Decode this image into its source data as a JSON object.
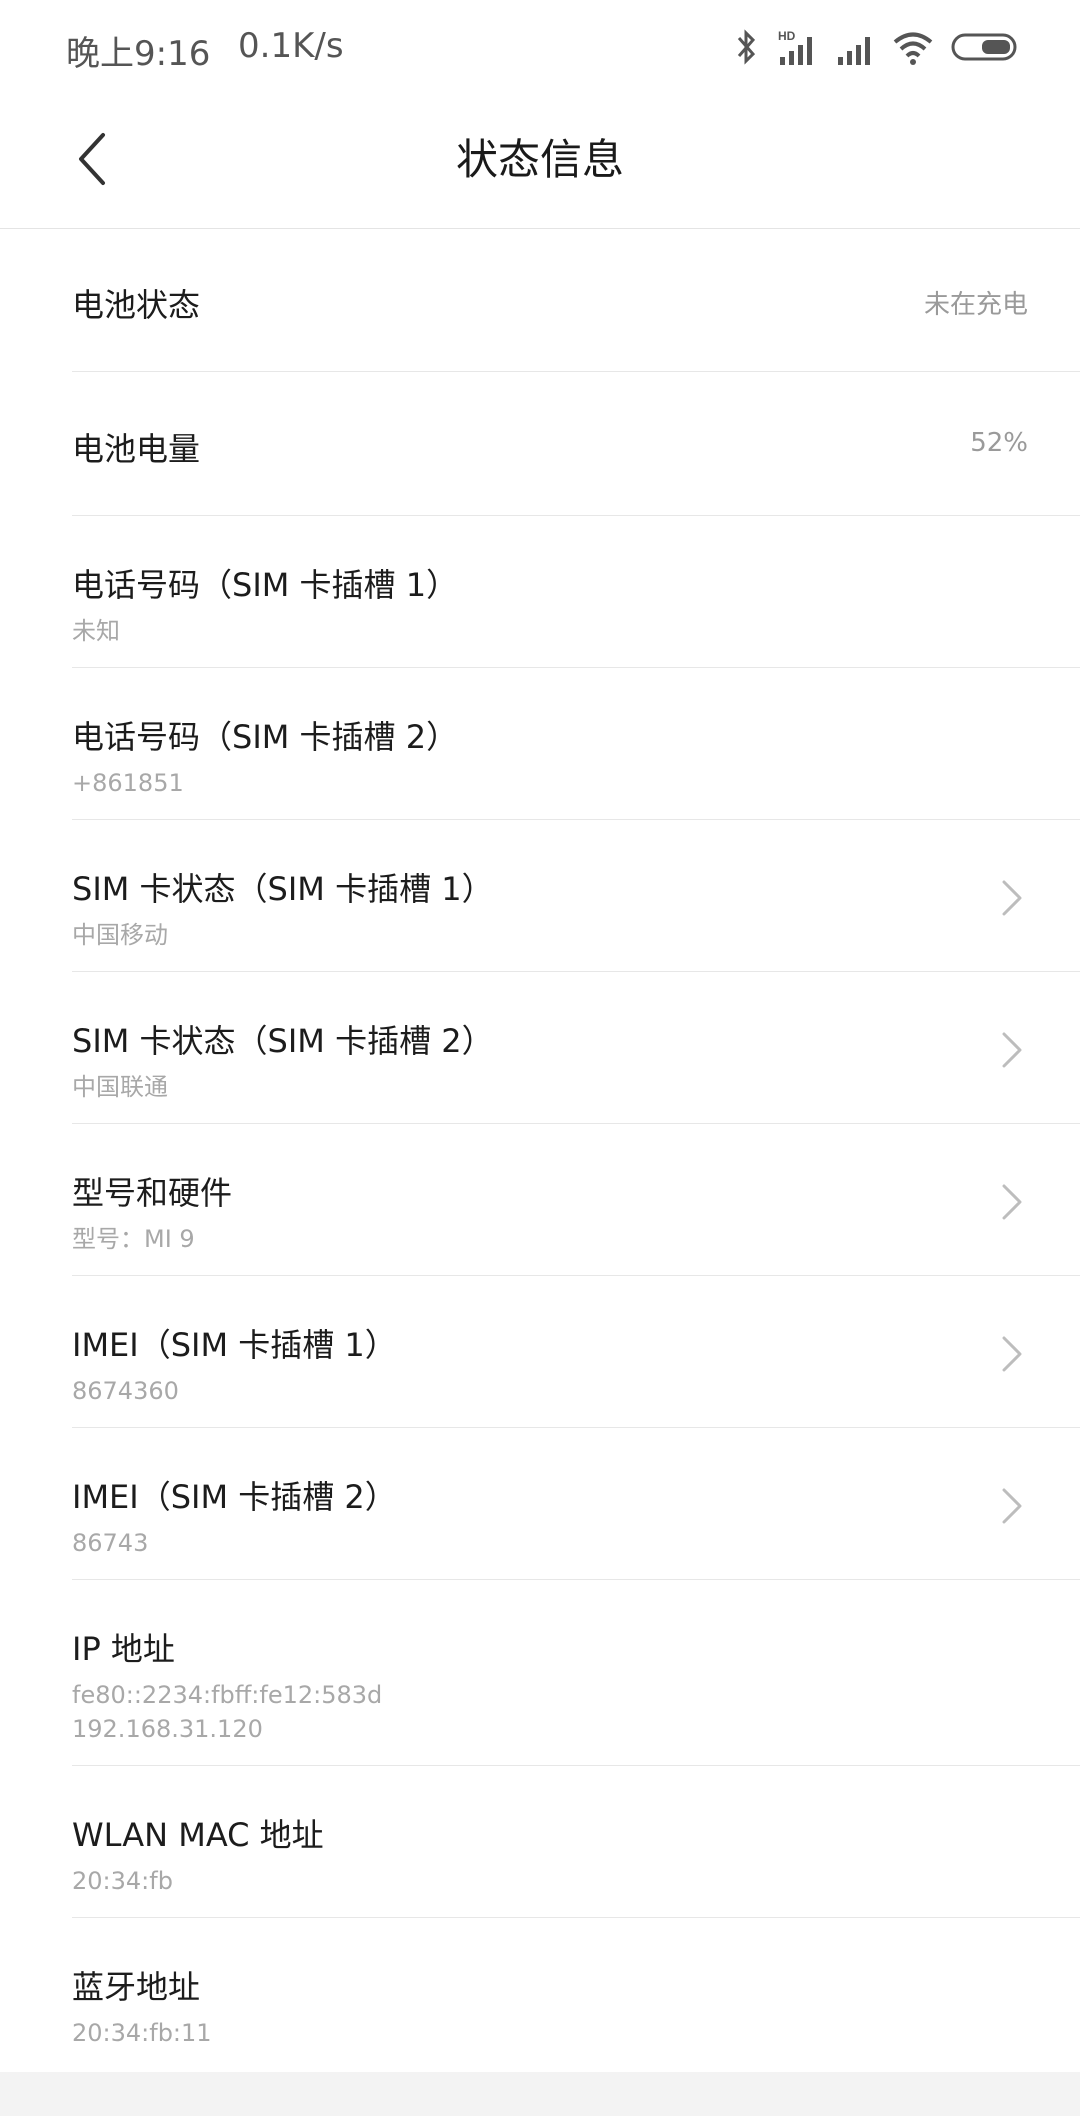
{
  "status_bar": {
    "time": "晚上9:16",
    "net_speed": "0.1K/s",
    "icons": [
      "bluetooth-icon",
      "hd-signal-icon",
      "signal-icon",
      "wifi-icon",
      "battery-icon"
    ],
    "hd_label": "HD"
  },
  "header": {
    "title": "状态信息",
    "back_icon": "back-chevron-icon"
  },
  "items": [
    {
      "title": "电池状态",
      "value": "未在充电"
    },
    {
      "title": "电池电量",
      "value": "52%"
    },
    {
      "title": "电话号码（SIM 卡插槽 1）",
      "subtitle": "未知"
    },
    {
      "title": "电话号码（SIM 卡插槽 2）",
      "subtitle": "+861851"
    },
    {
      "title": "SIM 卡状态（SIM 卡插槽 1）",
      "subtitle": "中国移动",
      "chevron": true
    },
    {
      "title": "SIM 卡状态（SIM 卡插槽 2）",
      "subtitle": "中国联通",
      "chevron": true
    },
    {
      "title": "型号和硬件",
      "subtitle": "型号：MI 9",
      "chevron": true
    },
    {
      "title": "IMEI（SIM 卡插槽 1）",
      "subtitle": "8674360",
      "chevron": true
    },
    {
      "title": "IMEI（SIM 卡插槽 2）",
      "subtitle": "86743",
      "chevron": true
    },
    {
      "title": "IP 地址",
      "subtitle": "fe80::2234:fbff:fe12:583d",
      "subtitle2": "192.168.31.120"
    },
    {
      "title": "WLAN MAC 地址",
      "subtitle": "20:34:fb"
    },
    {
      "title": "蓝牙地址",
      "subtitle": "20:34:fb:11"
    }
  ],
  "colors": {
    "title_text": "#1c1c1c",
    "secondary_text": "#a8a8a8",
    "divider": "#e7e7e7",
    "chevron": "#bdbdbd"
  }
}
